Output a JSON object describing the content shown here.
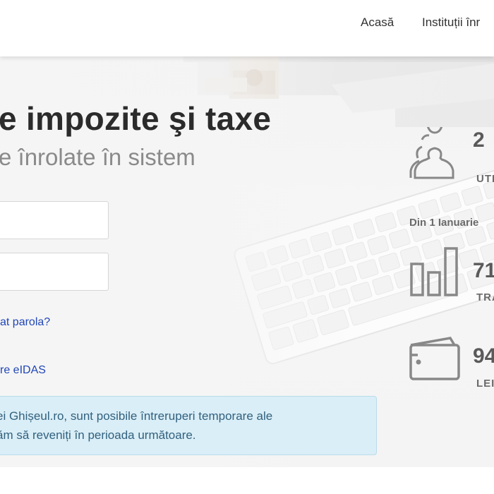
{
  "nav": {
    "items": [
      {
        "label": "Acasă"
      },
      {
        "label": "Instituții înr"
      }
    ]
  },
  "hero": {
    "title": "e impozite şi taxe",
    "subtitle": "e înrolate în sistem"
  },
  "login": {
    "username_value": "",
    "password_value": "",
    "forgot_link": "at parola?",
    "eidas_link": "re eIDAS"
  },
  "alert": {
    "line1": "ei Ghișeul.ro, sunt posibile întreruperi temporare ale",
    "line2": "ăm să reveniți în perioada următoare."
  },
  "stats": {
    "users": {
      "value": "2",
      "label": "UTI",
      "icon": "users-icon"
    },
    "since_text": "Din 1 Ianuarie",
    "transactions": {
      "value": "71",
      "label": "TRA",
      "icon": "bar-chart-icon"
    },
    "payments": {
      "value": "94",
      "label": "LEI",
      "icon": "wallet-icon"
    }
  }
}
